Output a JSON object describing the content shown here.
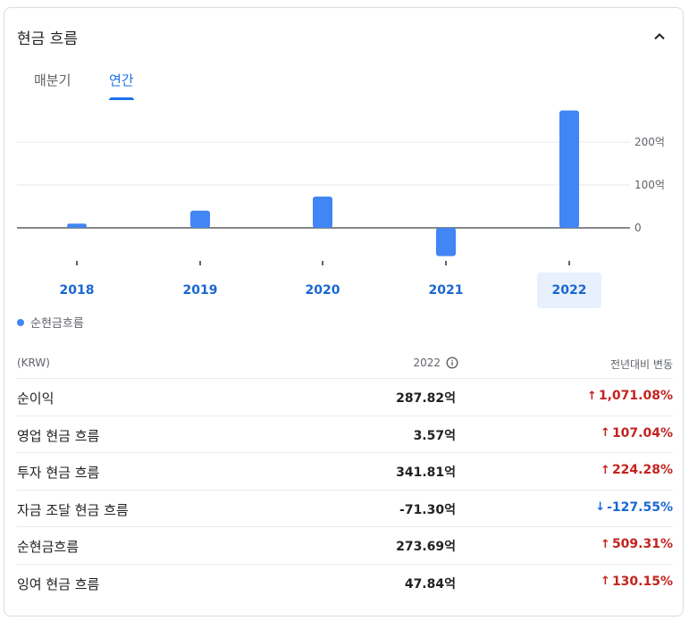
{
  "header": {
    "title": "현금 흐름"
  },
  "tabs": [
    {
      "label": "매분기",
      "active": false
    },
    {
      "label": "연간",
      "active": true
    }
  ],
  "chart_data": {
    "type": "bar",
    "categories": [
      "2018",
      "2019",
      "2020",
      "2021",
      "2022"
    ],
    "series": [
      {
        "name": "순현금흐름",
        "values": [
          10,
          40,
          73,
          -66,
          273.69
        ]
      }
    ],
    "yticks": [
      {
        "value": 0,
        "label": "0"
      },
      {
        "value": 100,
        "label": "100억"
      },
      {
        "value": 200,
        "label": "200억"
      }
    ],
    "ylim": [
      -70,
      280
    ],
    "selected_category": "2022",
    "color": "#4285f4"
  },
  "legend": {
    "label": "순현금흐름"
  },
  "table": {
    "header": {
      "label": "(KRW)",
      "year": "2022",
      "change": "전년대비 변동"
    },
    "rows": [
      {
        "label": "순이익",
        "value": "287.82억",
        "change": "1,071.08%",
        "direction": "up"
      },
      {
        "label": "영업 현금 흐름",
        "value": "3.57억",
        "change": "107.04%",
        "direction": "up"
      },
      {
        "label": "투자 현금 흐름",
        "value": "341.81억",
        "change": "224.28%",
        "direction": "up"
      },
      {
        "label": "자금 조달 현금 흐름",
        "value": "-71.30억",
        "change": "-127.55%",
        "direction": "down"
      },
      {
        "label": "순현금흐름",
        "value": "273.69억",
        "change": "509.31%",
        "direction": "up"
      },
      {
        "label": "잉여 현금 흐름",
        "value": "47.84억",
        "change": "130.15%",
        "direction": "up"
      }
    ]
  },
  "icons": {
    "collapse": "chevron-up-icon",
    "info": "info-icon",
    "up": "arrow-up-icon",
    "down": "arrow-down-icon"
  }
}
